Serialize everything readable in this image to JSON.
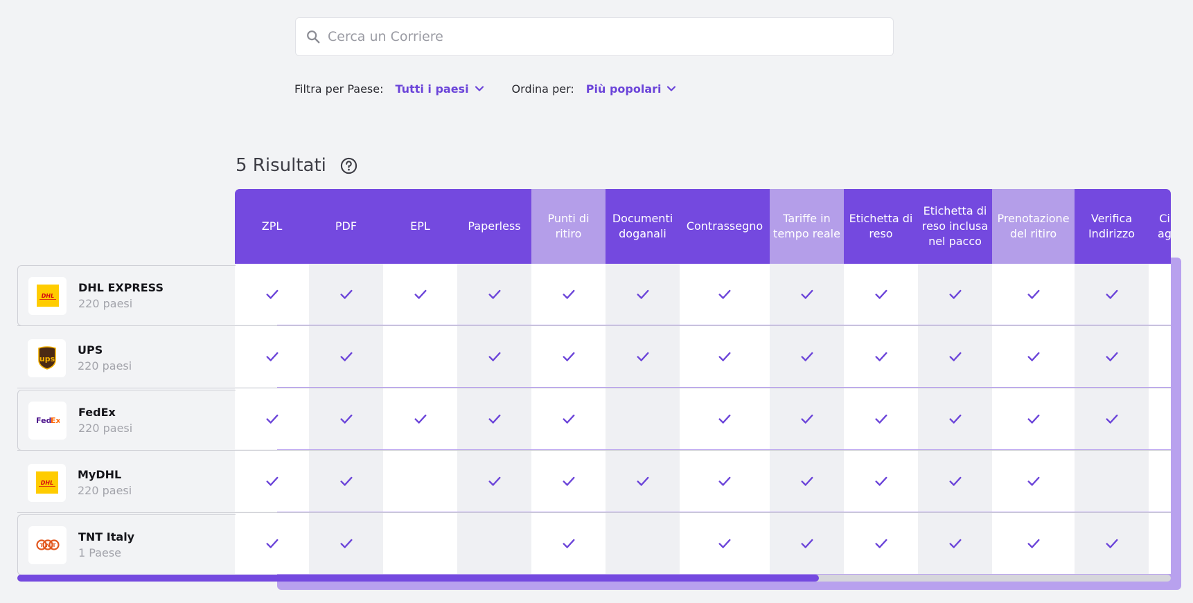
{
  "search": {
    "placeholder": "Cerca un Corriere"
  },
  "filters": {
    "country_label": "Filtra per Paese:",
    "country_value": "Tutti i paesi",
    "sort_label": "Ordina per:",
    "sort_value": "Più popolari"
  },
  "results": {
    "label": "5 Risultati"
  },
  "columns": [
    {
      "label": "ZPL",
      "highlight": false
    },
    {
      "label": "PDF",
      "highlight": false
    },
    {
      "label": "EPL",
      "highlight": false
    },
    {
      "label": "Paperless",
      "highlight": false
    },
    {
      "label": "Punti di ritiro",
      "highlight": true
    },
    {
      "label": "Documenti doganali",
      "highlight": false
    },
    {
      "label": "Contrassegno",
      "highlight": false
    },
    {
      "label": "Tariffe in tempo reale",
      "highlight": true
    },
    {
      "label": "Etichetta di reso",
      "highlight": false
    },
    {
      "label": "Etichetta di reso inclusa nel pacco",
      "highlight": false
    },
    {
      "label": "Prenotazione del ritiro",
      "highlight": true
    },
    {
      "label": "Verifica Indirizzo",
      "highlight": false
    },
    {
      "label": "Ci ag",
      "highlight": false
    }
  ],
  "carriers": [
    {
      "name": "DHL EXPRESS",
      "countries": "220 paesi",
      "logo": "dhl-logo",
      "features": [
        true,
        true,
        true,
        true,
        true,
        true,
        true,
        true,
        true,
        true,
        true,
        true,
        false
      ]
    },
    {
      "name": "UPS",
      "countries": "220 paesi",
      "logo": "ups-logo",
      "features": [
        true,
        true,
        false,
        true,
        true,
        true,
        true,
        true,
        true,
        true,
        true,
        true,
        false
      ]
    },
    {
      "name": "FedEx",
      "countries": "220 paesi",
      "logo": "fedex-logo",
      "features": [
        true,
        true,
        true,
        true,
        true,
        false,
        true,
        true,
        true,
        true,
        true,
        true,
        false
      ]
    },
    {
      "name": "MyDHL",
      "countries": "220 paesi",
      "logo": "dhl-logo",
      "features": [
        true,
        true,
        false,
        true,
        true,
        true,
        true,
        true,
        true,
        true,
        true,
        false,
        false
      ]
    },
    {
      "name": "TNT Italy",
      "countries": "1 Paese",
      "logo": "tnt-logo",
      "features": [
        true,
        true,
        false,
        false,
        true,
        false,
        true,
        true,
        true,
        true,
        true,
        true,
        false
      ]
    }
  ],
  "colors": {
    "accent": "#7449df",
    "accent_light": "#b49ee9",
    "check": "#6b44d9"
  }
}
